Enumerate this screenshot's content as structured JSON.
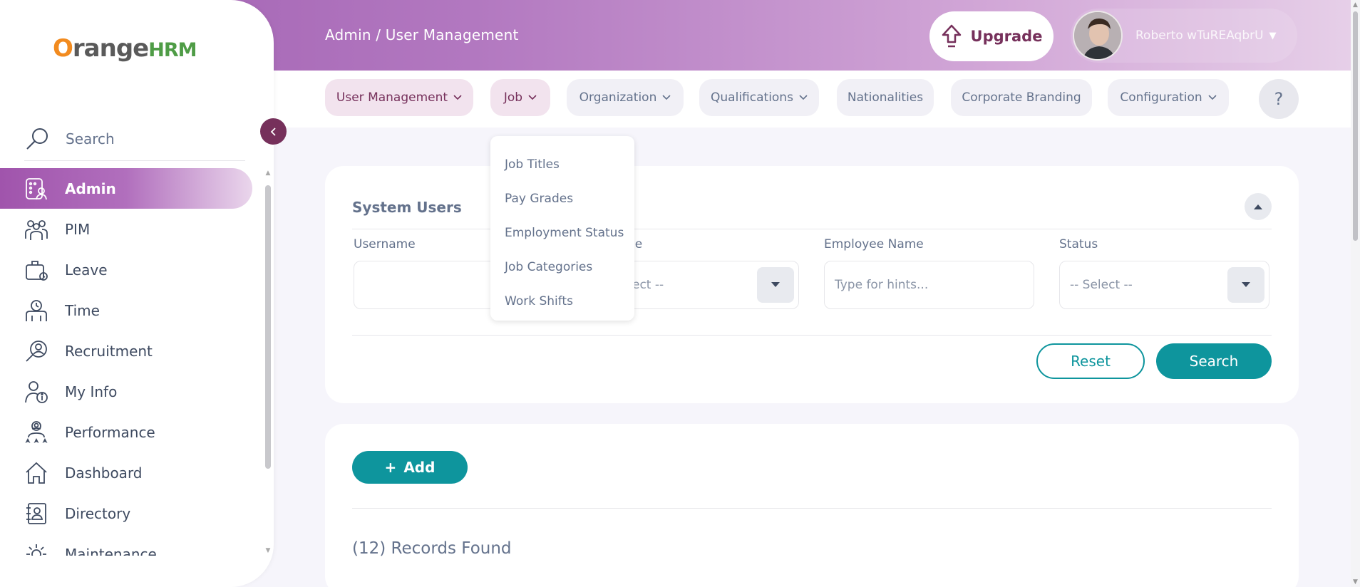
{
  "header": {
    "breadcrumb": "Admin / User Management",
    "upgrade_label": "Upgrade",
    "user_name": "Roberto wTuREAqbrU"
  },
  "brand": {
    "logo_o": "O",
    "logo_range": "range",
    "logo_hrm": "HRM"
  },
  "sidebar": {
    "search_label": "Search",
    "items": [
      {
        "label": "Admin",
        "icon": "admin-icon"
      },
      {
        "label": "PIM",
        "icon": "pim-icon"
      },
      {
        "label": "Leave",
        "icon": "leave-icon"
      },
      {
        "label": "Time",
        "icon": "time-icon"
      },
      {
        "label": "Recruitment",
        "icon": "recruitment-icon"
      },
      {
        "label": "My Info",
        "icon": "my-info-icon"
      },
      {
        "label": "Performance",
        "icon": "performance-icon"
      },
      {
        "label": "Dashboard",
        "icon": "dashboard-icon"
      },
      {
        "label": "Directory",
        "icon": "directory-icon"
      },
      {
        "label": "Maintenance",
        "icon": "maintenance-icon"
      }
    ]
  },
  "topnav": {
    "items": [
      {
        "label": "User Management"
      },
      {
        "label": "Job"
      },
      {
        "label": "Organization"
      },
      {
        "label": "Qualifications"
      },
      {
        "label": "Nationalities"
      },
      {
        "label": "Corporate Branding"
      },
      {
        "label": "Configuration"
      }
    ],
    "help": "?"
  },
  "job_menu": {
    "items": [
      "Job Titles",
      "Pay Grades",
      "Employment Status",
      "Job Categories",
      "Work Shifts"
    ]
  },
  "filters": {
    "title": "System Users",
    "username_label": "Username",
    "username_value": "",
    "role_label_partial": "le",
    "role_value_partial": "ect --",
    "employee_label": "Employee Name",
    "employee_placeholder": "Type for hints...",
    "status_label": "Status",
    "status_value": "-- Select --",
    "reset_label": "Reset",
    "search_label": "Search"
  },
  "records": {
    "add_label": "Add",
    "add_symbol": "+",
    "count_text": "(12) Records Found"
  },
  "colors": {
    "brand_purple": "#76305b",
    "accent_teal": "#0e959d",
    "text_gray": "#64728c"
  }
}
